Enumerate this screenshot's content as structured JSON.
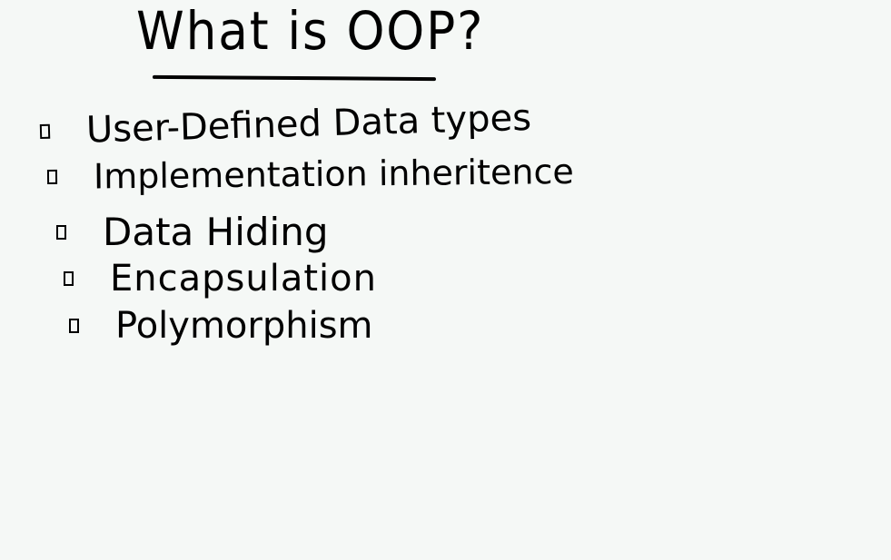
{
  "whiteboard": {
    "title": "What is OOP?",
    "items": [
      {
        "label": "User-Defined Data types"
      },
      {
        "label": "Implementation inheritence"
      },
      {
        "label": "Data Hiding"
      },
      {
        "label": "Encapsulation"
      },
      {
        "label": "Polymorphism"
      }
    ]
  }
}
